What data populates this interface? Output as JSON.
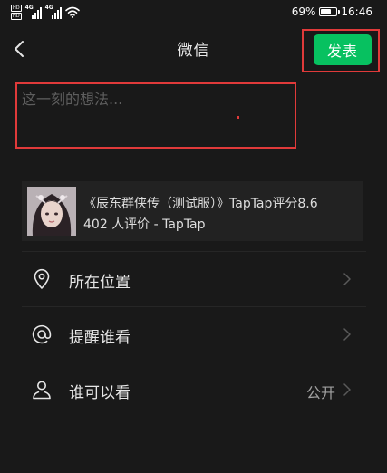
{
  "status_bar": {
    "hd1": "HD",
    "hd2": "HD",
    "sig1_label": "4G",
    "sig2_label": "4G",
    "battery_percent": "69%",
    "battery_level": 0.69,
    "time": "16:46",
    "icons": [
      "hd-icon",
      "signal-4g-icon",
      "wifi-icon",
      "battery-icon"
    ]
  },
  "header": {
    "title": "微信",
    "post_label": "发表"
  },
  "compose": {
    "placeholder": "这一刻的想法...",
    "value": ""
  },
  "shared_link": {
    "title": "《辰东群侠传（测试服）》TapTap评分8.6",
    "subtitle": "402 人评价 - TapTap"
  },
  "options": [
    {
      "label": "所在位置",
      "value": "",
      "icon": "location-pin-icon"
    },
    {
      "label": "提醒谁看",
      "value": "",
      "icon": "at-sign-icon"
    },
    {
      "label": "谁可以看",
      "value": "公开",
      "icon": "person-icon"
    }
  ],
  "colors": {
    "background": "#191919",
    "accent": "#07c160",
    "highlight_box": "#e03a3a"
  }
}
